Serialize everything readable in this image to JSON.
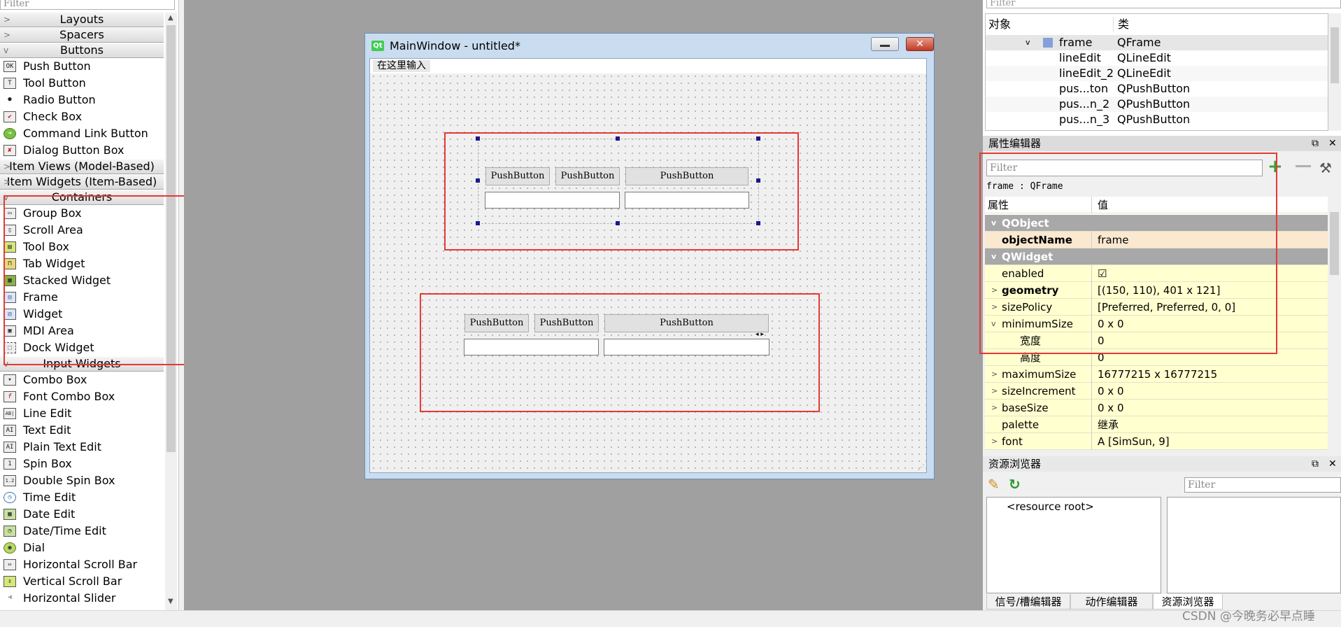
{
  "widget_box": {
    "filter_placeholder": "Filter",
    "categories": [
      {
        "label": "Layouts",
        "state": "collapsed"
      },
      {
        "label": "Spacers",
        "state": "collapsed"
      },
      {
        "label": "Buttons",
        "state": "expanded"
      },
      {
        "label": "Item Views (Model-Based)",
        "state": "collapsed"
      },
      {
        "label": "Item Widgets (Item-Based)",
        "state": "collapsed"
      },
      {
        "label": "Containers",
        "state": "expanded"
      },
      {
        "label": "Input Widgets",
        "state": "expanded"
      }
    ],
    "buttons": [
      {
        "label": "Push Button",
        "icon": "OK"
      },
      {
        "label": "Tool Button",
        "icon": "T"
      },
      {
        "label": "Radio Button",
        "icon": "●"
      },
      {
        "label": "Check Box",
        "icon": "✔"
      },
      {
        "label": "Command Link Button",
        "icon": "➜"
      },
      {
        "label": "Dialog Button Box",
        "icon": "✘"
      }
    ],
    "containers": [
      {
        "label": "Group Box",
        "icon": "▭"
      },
      {
        "label": "Scroll Area",
        "icon": "▯"
      },
      {
        "label": "Tool Box",
        "icon": "▤"
      },
      {
        "label": "Tab Widget",
        "icon": "⊓"
      },
      {
        "label": "Stacked Widget",
        "icon": "▦"
      },
      {
        "label": "Frame",
        "icon": "▨"
      },
      {
        "label": "Widget",
        "icon": "▧"
      },
      {
        "label": "MDI Area",
        "icon": "▣"
      },
      {
        "label": "Dock Widget",
        "icon": "⬚"
      }
    ],
    "inputs": [
      {
        "label": "Combo Box",
        "icon": "▾"
      },
      {
        "label": "Font Combo Box",
        "icon": "f"
      },
      {
        "label": "Line Edit",
        "icon": "AB|"
      },
      {
        "label": "Text Edit",
        "icon": "AI"
      },
      {
        "label": "Plain Text Edit",
        "icon": "AI"
      },
      {
        "label": "Spin Box",
        "icon": "1"
      },
      {
        "label": "Double Spin Box",
        "icon": "1.2"
      },
      {
        "label": "Time Edit",
        "icon": "◷"
      },
      {
        "label": "Date Edit",
        "icon": "▦"
      },
      {
        "label": "Date/Time Edit",
        "icon": "◷"
      },
      {
        "label": "Dial",
        "icon": "◉"
      },
      {
        "label": "Horizontal Scroll Bar",
        "icon": "⇔"
      },
      {
        "label": "Vertical Scroll Bar",
        "icon": "⇕"
      },
      {
        "label": "Horizontal Slider",
        "icon": "⊣"
      }
    ]
  },
  "main_window": {
    "title": "MainWindow - untitled*",
    "app_badge": "Qt",
    "close_glyph": "✕",
    "menu_placeholder": "在这里输入",
    "push_button_label": "PushButton",
    "resize_arrows": "◂ ▸"
  },
  "object_inspector": {
    "filter_placeholder": "Filter",
    "col_object": "对象",
    "col_class": "类",
    "rows": [
      {
        "name": "frame",
        "class": "QFrame",
        "selected": true
      },
      {
        "name": "lineEdit",
        "class": "QLineEdit"
      },
      {
        "name": "lineEdit_2",
        "class": "QLineEdit"
      },
      {
        "name": "pus...ton",
        "class": "QPushButton"
      },
      {
        "name": "pus...n_2",
        "class": "QPushButton"
      },
      {
        "name": "pus...n_3",
        "class": "QPushButton"
      }
    ]
  },
  "property_editor": {
    "title": "属性编辑器",
    "filter_placeholder": "Filter",
    "object_label": "frame : QFrame",
    "col_property": "属性",
    "col_value": "值",
    "group_qobject": "QObject",
    "group_qwidget": "QWidget",
    "rows": [
      {
        "name": "objectName",
        "value": "frame"
      },
      {
        "name": "enabled",
        "value": "☑"
      },
      {
        "name": "geometry",
        "value": "[(150, 110), 401 x 121]"
      },
      {
        "name": "sizePolicy",
        "value": "[Preferred, Preferred, 0, 0]"
      },
      {
        "name": "minimumSize",
        "value": "0 x 0"
      },
      {
        "name": "宽度",
        "value": "0"
      },
      {
        "name": "高度",
        "value": "0"
      },
      {
        "name": "maximumSize",
        "value": "16777215 x 16777215"
      },
      {
        "name": "sizeIncrement",
        "value": "0 x 0"
      },
      {
        "name": "baseSize",
        "value": "0 x 0"
      },
      {
        "name": "palette",
        "value": "继承"
      },
      {
        "name": "font",
        "value": "A  [SimSun, 9]"
      }
    ]
  },
  "resource_browser": {
    "title": "资源浏览器",
    "filter_placeholder": "Filter",
    "root": "<resource root>"
  },
  "bottom_tabs": [
    "信号/槽编辑器",
    "动作编辑器",
    "资源浏览器"
  ],
  "dock_buttons": {
    "float": "⧉",
    "close": "✕"
  },
  "watermark": "CSDN @今晚务必早点睡",
  "colors": {
    "highlight_red": "#e53935",
    "group_gray": "#a8a8a8",
    "prop_yellow": "#ffffd0"
  }
}
